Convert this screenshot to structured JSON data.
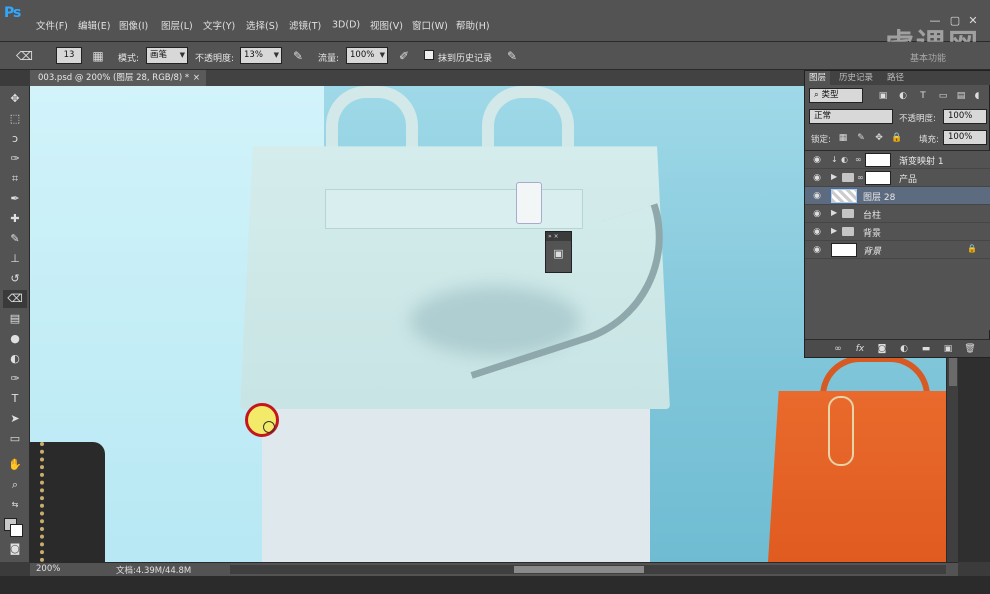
{
  "app": {
    "logo": "Ps",
    "watermark": "虎课网"
  },
  "menu": [
    "文件(F)",
    "编辑(E)",
    "图像(I)",
    "图层(L)",
    "文字(Y)",
    "选择(S)",
    "滤镜(T)",
    "3D(D)",
    "视图(V)",
    "窗口(W)",
    "帮助(H)"
  ],
  "window_controls": {
    "minimize": "—",
    "maximize": "▢",
    "close": "✕"
  },
  "options": {
    "brush_size": "13",
    "mode_label": "模式:",
    "mode_value": "画笔",
    "opacity_label": "不透明度:",
    "opacity_value": "13%",
    "flow_label": "流量:",
    "flow_value": "100%",
    "history_label": "抹到历史记录",
    "history_checked": false,
    "workspace": "基本功能"
  },
  "document": {
    "tab_title": "003.psd @ 200% (图层 28, RGB/8) *",
    "tab_close": "×"
  },
  "status": {
    "zoom": "200%",
    "doc_info": "文档:4.39M/44.8M"
  },
  "layers_panel": {
    "tabs": [
      "图层",
      "历史记录",
      "路径"
    ],
    "filter_label": "类型",
    "blend_mode": "正常",
    "opacity_label": "不透明度:",
    "opacity_value": "100%",
    "lock_label": "锁定:",
    "fill_label": "填充:",
    "fill_value": "100%",
    "layers": [
      {
        "name": "渐变映射 1",
        "visible": true,
        "selected": false
      },
      {
        "name": "产品",
        "visible": true,
        "selected": false
      },
      {
        "name": "图层 28",
        "visible": true,
        "selected": true
      },
      {
        "name": "台柱",
        "visible": true,
        "selected": false
      },
      {
        "name": "背景",
        "visible": true,
        "selected": false
      },
      {
        "name": "背景",
        "visible": true,
        "selected": false,
        "locked": true
      }
    ],
    "footer_icons": [
      "link-icon",
      "fx-icon",
      "mask-icon",
      "adjustment-icon",
      "group-icon",
      "new-layer-icon",
      "delete-icon"
    ]
  },
  "colors": {
    "accent": "#31a8ff",
    "selected_layer": "#5d6b80",
    "canvas_bg": "#c3eef7",
    "cursor_fill": "#f3ea6a",
    "cursor_ring": "#c4161c"
  }
}
